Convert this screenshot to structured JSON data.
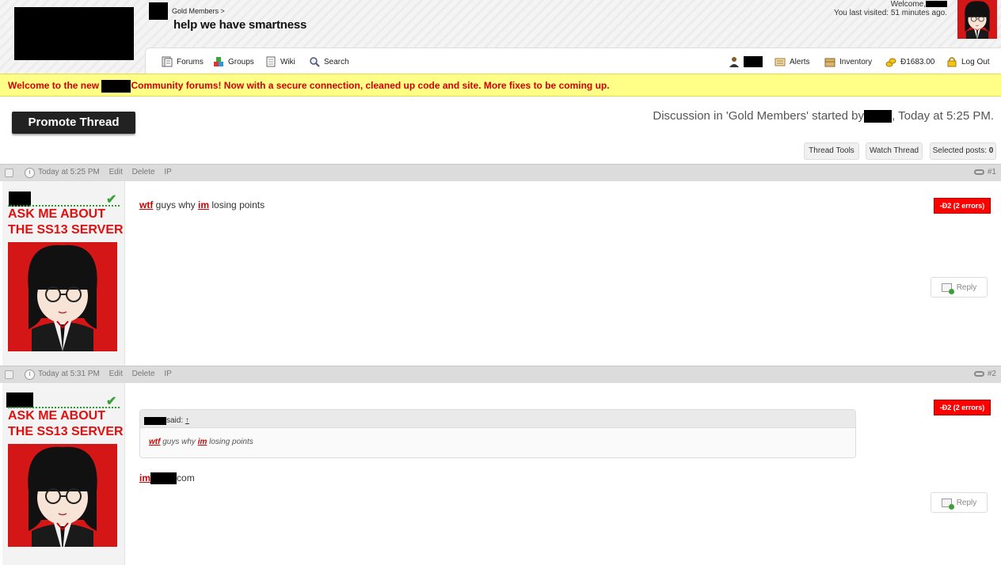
{
  "header": {
    "breadcrumb": "Gold Members >",
    "thread_title": "help we have smartness",
    "welcome": "Welcome,",
    "last_visited": "You last visited: 51 minutes ago."
  },
  "nav": {
    "forums": "Forums",
    "groups": "Groups",
    "wiki": "Wiki",
    "search": "Search",
    "alerts": "Alerts",
    "inventory": "Inventory",
    "balance": "Đ1683.00",
    "logout": "Log Out"
  },
  "notice": {
    "part1": "Welcome to the new ",
    "part2": "Community forums! Now with a secure connection, cleaned up code and site. More fixes to be coming up."
  },
  "promote_label": "Promote Thread",
  "discussion": {
    "prefix": "Discussion in 'Gold Members' started by",
    "suffix": ", Today at 5:25 PM."
  },
  "tools": {
    "thread_tools": "Thread Tools",
    "watch_thread": "Watch Thread",
    "selected_posts_label": "Selected posts: ",
    "selected_posts_count": "0"
  },
  "posts": [
    {
      "time": "Today at 5:25 PM",
      "edit": "Edit",
      "delete": "Delete",
      "ip": "IP",
      "number": "#1",
      "user_title": "ASK ME ABOUT THE SS13 SERVER",
      "message": {
        "w1": "wtf",
        "t1": " guys why ",
        "w2": "im",
        "t2": " losing points"
      },
      "error_badge": "-Đ2 (2 errors)",
      "reply": "Reply"
    },
    {
      "time": "Today at 5:31 PM",
      "edit": "Edit",
      "delete": "Delete",
      "ip": "IP",
      "number": "#2",
      "user_title": "ASK ME ABOUT THE SS13 SERVER",
      "quote": {
        "said": "said:",
        "arrow": "↑",
        "w1": "wtf",
        "t1": " guys why ",
        "w2": "im",
        "t2": " losing points"
      },
      "message": {
        "w1": "im",
        "t1": "com"
      },
      "error_badge": "-Đ2 (2 errors)",
      "reply": "Reply"
    }
  ],
  "colors": {
    "notice_bg": "#ffff88",
    "notice_text": "#d40000",
    "error_badge": "#ff0000",
    "user_title": "#e01010",
    "avatar_bg": "#d41616"
  }
}
